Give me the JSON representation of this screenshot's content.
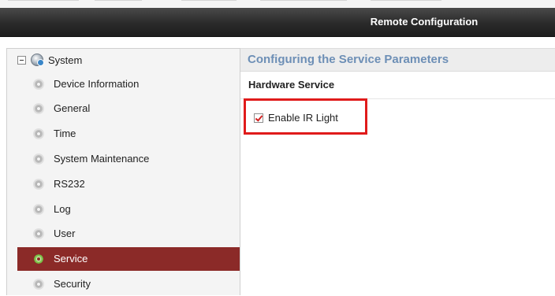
{
  "window": {
    "title": "Remote Configuration"
  },
  "sidebar": {
    "root": {
      "label": "System",
      "expanded": true
    },
    "items": [
      {
        "label": "Device Information",
        "selected": false
      },
      {
        "label": "General",
        "selected": false
      },
      {
        "label": "Time",
        "selected": false
      },
      {
        "label": "System Maintenance",
        "selected": false
      },
      {
        "label": "RS232",
        "selected": false
      },
      {
        "label": "Log",
        "selected": false
      },
      {
        "label": "User",
        "selected": false
      },
      {
        "label": "Service",
        "selected": true
      },
      {
        "label": "Security",
        "selected": false
      }
    ],
    "item_icon": "gear-icon"
  },
  "main": {
    "section_title": "Configuring the Service Parameters",
    "subsection_title": "Hardware Service",
    "options": [
      {
        "label": "Enable IR Light",
        "checked": true,
        "highlighted": true
      }
    ]
  },
  "colors": {
    "selected_bg": "#8b2a28",
    "section_title": "#6d8fb6",
    "highlight_box": "#e01b1b",
    "titlebar": "#2a2a2a"
  }
}
